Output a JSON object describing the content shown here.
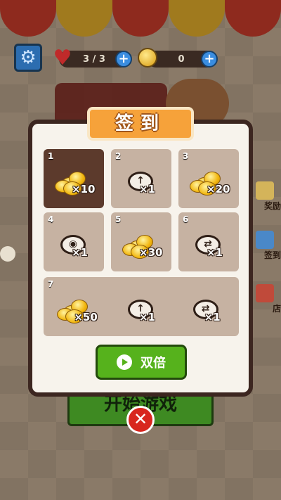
{
  "hud": {
    "hp_text": "3 / 3",
    "coin_text": "0"
  },
  "background": {
    "start_button": "开始游戏",
    "side_items": [
      "奖励",
      "签到",
      "店"
    ]
  },
  "modal": {
    "title": "签到",
    "double_button": "双倍",
    "days": [
      {
        "num": "1",
        "rewards": [
          {
            "type": "coin",
            "qty": "×10"
          }
        ],
        "claimed": true
      },
      {
        "num": "2",
        "rewards": [
          {
            "type": "tool-up",
            "qty": "×1"
          }
        ],
        "claimed": false
      },
      {
        "num": "3",
        "rewards": [
          {
            "type": "coin",
            "qty": "×20"
          }
        ],
        "claimed": false
      },
      {
        "num": "4",
        "rewards": [
          {
            "type": "tool-eye",
            "qty": "×1"
          }
        ],
        "claimed": false
      },
      {
        "num": "5",
        "rewards": [
          {
            "type": "coin",
            "qty": "×30"
          }
        ],
        "claimed": false
      },
      {
        "num": "6",
        "rewards": [
          {
            "type": "tool-swap",
            "qty": "×1"
          }
        ],
        "claimed": false
      },
      {
        "num": "7",
        "rewards": [
          {
            "type": "coin",
            "qty": "×50"
          },
          {
            "type": "tool-up",
            "qty": "×1"
          },
          {
            "type": "tool-swap",
            "qty": "×1"
          }
        ],
        "claimed": false
      }
    ]
  },
  "colors": {
    "accent_orange": "#f6a23a",
    "claimed_card": "#5c3a2c",
    "unclaimed_card": "#c6b2a2",
    "double_button": "#56b21c"
  }
}
